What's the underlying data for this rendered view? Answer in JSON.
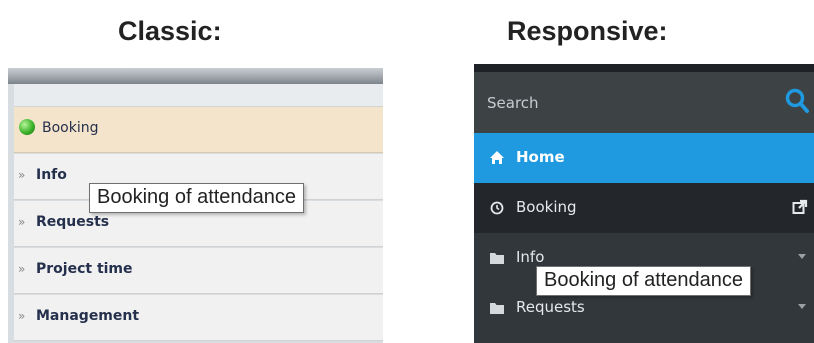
{
  "headings": {
    "classic": "Classic:",
    "responsive": "Responsive:"
  },
  "classic": {
    "items": [
      {
        "label": "Booking",
        "icon": "globe-icon",
        "active": true
      },
      {
        "label": "Info"
      },
      {
        "label": "Requests"
      },
      {
        "label": "Project time"
      },
      {
        "label": "Management"
      }
    ],
    "arrow_glyph": "»",
    "tooltip": "Booking of attendance",
    "colors": {
      "active_row": "#f4e4cb",
      "row": "#f1f1f1",
      "text": "#25304d"
    }
  },
  "responsive": {
    "search_placeholder": "Search",
    "items": [
      {
        "label": "Home",
        "icon": "home-icon",
        "active": true
      },
      {
        "label": "Booking",
        "icon": "clock-icon",
        "trailing_icon": "external-link-icon"
      },
      {
        "label": "Info",
        "icon": "folder-icon",
        "trailing_icon": "caret-down-icon"
      },
      {
        "label": "Requests",
        "icon": "folder-icon",
        "trailing_icon": "caret-down-icon"
      }
    ],
    "tooltip": "Booking of attendance",
    "colors": {
      "active_row": "#1f9ae0",
      "background": "#32373b",
      "search_icon": "#1f9ae0"
    }
  }
}
